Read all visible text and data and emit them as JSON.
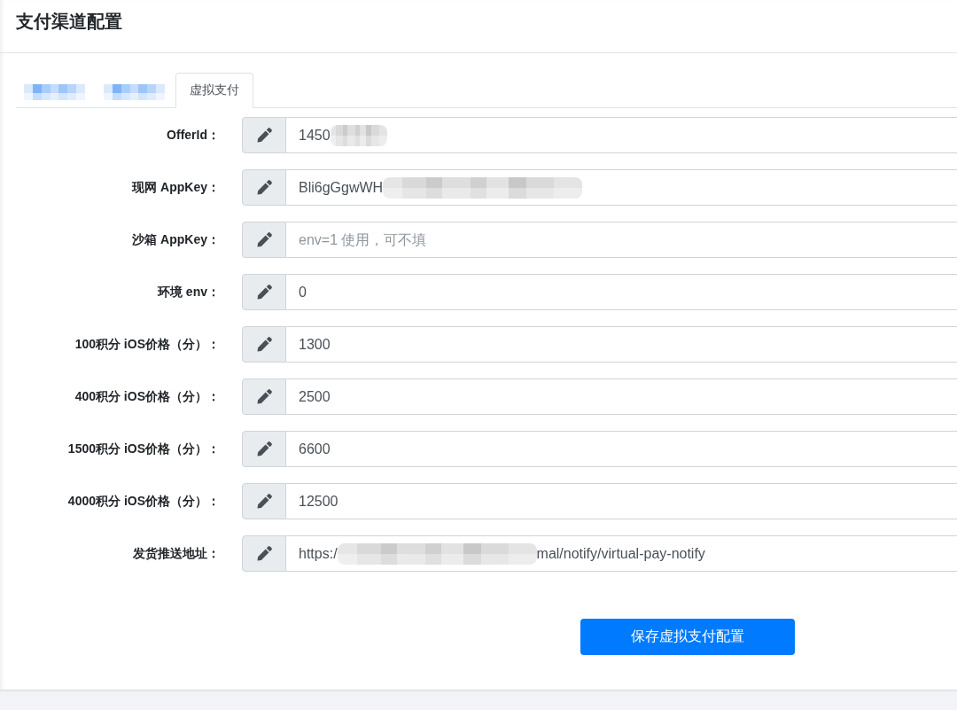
{
  "page_title": "支付渠道配置",
  "tabs": [
    {
      "redacted": true,
      "selected": false
    },
    {
      "redacted": true,
      "selected": false
    },
    {
      "label": "虚拟支付",
      "redacted": false,
      "selected": true
    }
  ],
  "fields": [
    {
      "kind": "partial",
      "label": "OfferId：",
      "value": "1450"
    },
    {
      "kind": "obscured",
      "label": "现网 AppKey：",
      "value": "Bli6gGgwWH"
    },
    {
      "kind": "plain",
      "label": "沙箱 AppKey：",
      "placeholder": "env=1 使用，可不填"
    },
    {
      "kind": "plain",
      "label": "环境 env：",
      "value": "0"
    },
    {
      "kind": "plain",
      "label": "100积分 iOS价格（分）：",
      "value": "1300"
    },
    {
      "kind": "plain",
      "label": "400积分 iOS价格（分）：",
      "value": "2500"
    },
    {
      "kind": "plain",
      "label": "1500积分 iOS价格（分）：",
      "value": "6600"
    },
    {
      "kind": "plain",
      "label": "4000积分 iOS价格（分）：",
      "value": "12500"
    },
    {
      "kind": "obscured",
      "label": "发货推送地址：",
      "value": "https:/",
      "value_after": "mal/notify/virtual-pay-notify"
    }
  ],
  "save_button": "保存虚拟支付配置"
}
